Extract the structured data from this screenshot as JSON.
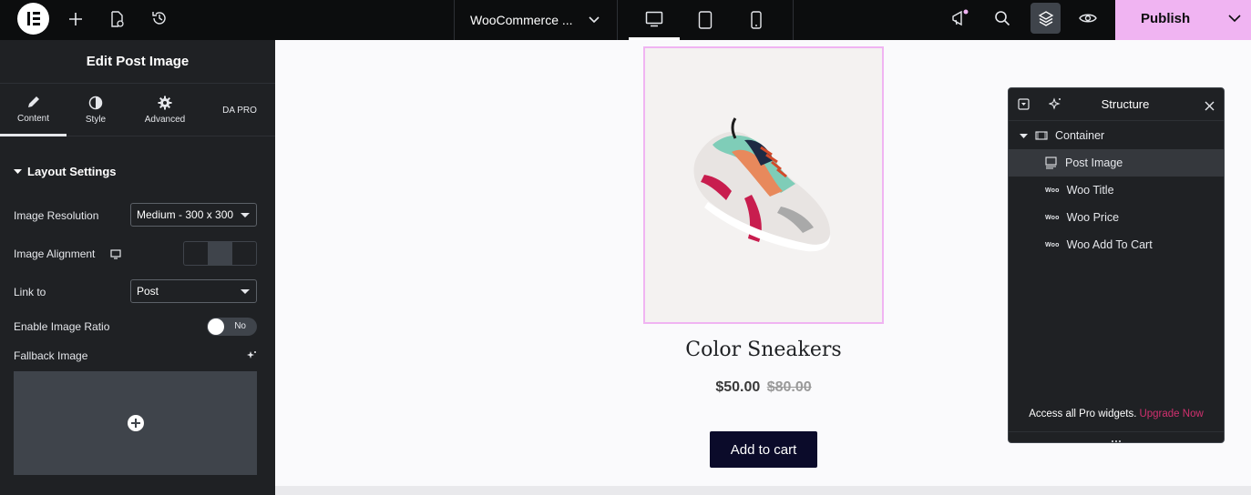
{
  "topbar": {
    "page_name": "WooCommerce ...",
    "publish_label": "Publish",
    "accent": "#f0b4f2"
  },
  "panel": {
    "title": "Edit Post Image",
    "tabs": [
      {
        "label": "Content",
        "icon": "pencil-icon",
        "active": true
      },
      {
        "label": "Style",
        "icon": "half-circle-icon",
        "active": false
      },
      {
        "label": "Advanced",
        "icon": "gear-icon",
        "active": false
      },
      {
        "label": "DA PRO",
        "icon": "",
        "active": false
      }
    ],
    "section": "Layout Settings",
    "controls": {
      "image_resolution_label": "Image Resolution",
      "image_resolution_value": "Medium - 300 x 300",
      "image_alignment_label": "Image Alignment",
      "link_to_label": "Link to",
      "link_to_value": "Post",
      "enable_ratio_label": "Enable Image Ratio",
      "enable_ratio_value": "No",
      "fallback_label": "Fallback Image"
    }
  },
  "product": {
    "title": "Color Sneakers",
    "price": "$50.00",
    "old_price": "$80.00",
    "add_to_cart": "Add to cart"
  },
  "structure": {
    "title": "Structure",
    "items": [
      {
        "label": "Container",
        "icon": "container-icon",
        "level": 0
      },
      {
        "label": "Post Image",
        "icon": "post-image-icon",
        "level": 1,
        "selected": true
      },
      {
        "label": "Woo Title",
        "icon": "woo-icon",
        "level": 1
      },
      {
        "label": "Woo Price",
        "icon": "woo-icon",
        "level": 1
      },
      {
        "label": "Woo Add To Cart",
        "icon": "woo-icon",
        "level": 1
      }
    ],
    "woo_badge": "Woo",
    "footer_text": "Access all Pro widgets.",
    "footer_link": "Upgrade Now"
  }
}
